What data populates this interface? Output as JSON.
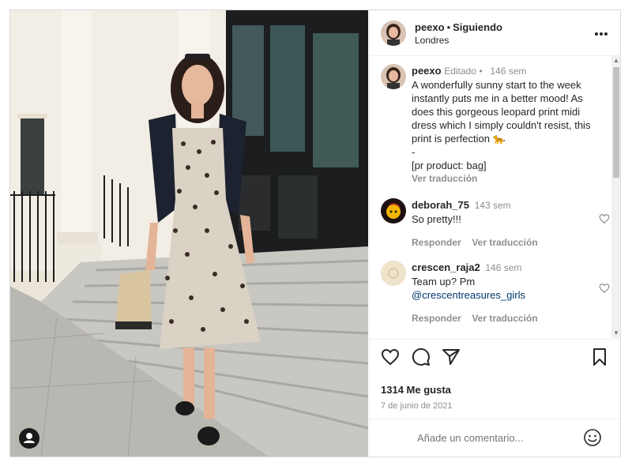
{
  "post": {
    "username": "peexo",
    "separator": "•",
    "follow_status": "Siguiendo",
    "location": "Londres",
    "more_icon": "more-horizontal-icon"
  },
  "caption": {
    "username": "peexo",
    "edited": "Editado",
    "dot": "•",
    "time": "146 sem",
    "text": "A wonderfully sunny start to the week instantly puts me in a better mood! As does this gorgeous leopard print midi dress which I simply couldn't resist, this print is perfection 🐆",
    "dash": "-",
    "pr_line": "[pr product: bag]",
    "translate": "Ver traducción"
  },
  "comments": [
    {
      "username": "deborah_75",
      "time": "143 sem",
      "text": "So pretty!!!",
      "reply": "Responder",
      "translate": "Ver traducción"
    },
    {
      "username": "crescen_raja2",
      "time": "146 sem",
      "text": "Team up? Pm",
      "mention": "@crescentreasures_girls",
      "reply": "Responder",
      "translate": "Ver traducción"
    }
  ],
  "stats": {
    "likes": "1314 Me gusta",
    "date": "7 de junio de 2021"
  },
  "composer": {
    "placeholder": "Añade un comentario..."
  },
  "colors": {
    "text": "#262626",
    "muted": "#8e8e8e",
    "link": "#00376b",
    "border": "#efefef"
  }
}
